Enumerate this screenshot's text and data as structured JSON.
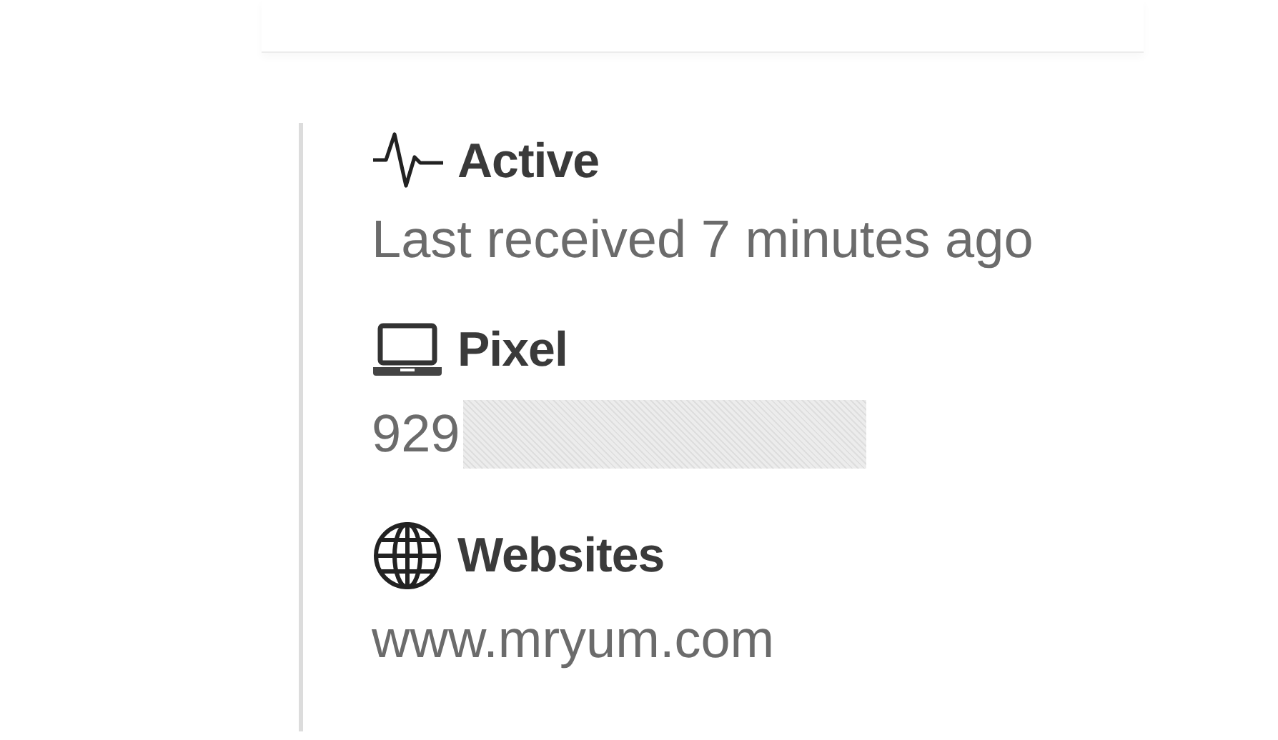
{
  "details": [
    {
      "kind": "pulse",
      "title": "Active",
      "value": "Last received 7 minutes ago",
      "redacted": false
    },
    {
      "kind": "laptop",
      "title": "Pixel",
      "value": "929",
      "redacted": true
    },
    {
      "kind": "globe",
      "title": "Websites",
      "value": "www.mryum.com",
      "redacted": false
    }
  ]
}
